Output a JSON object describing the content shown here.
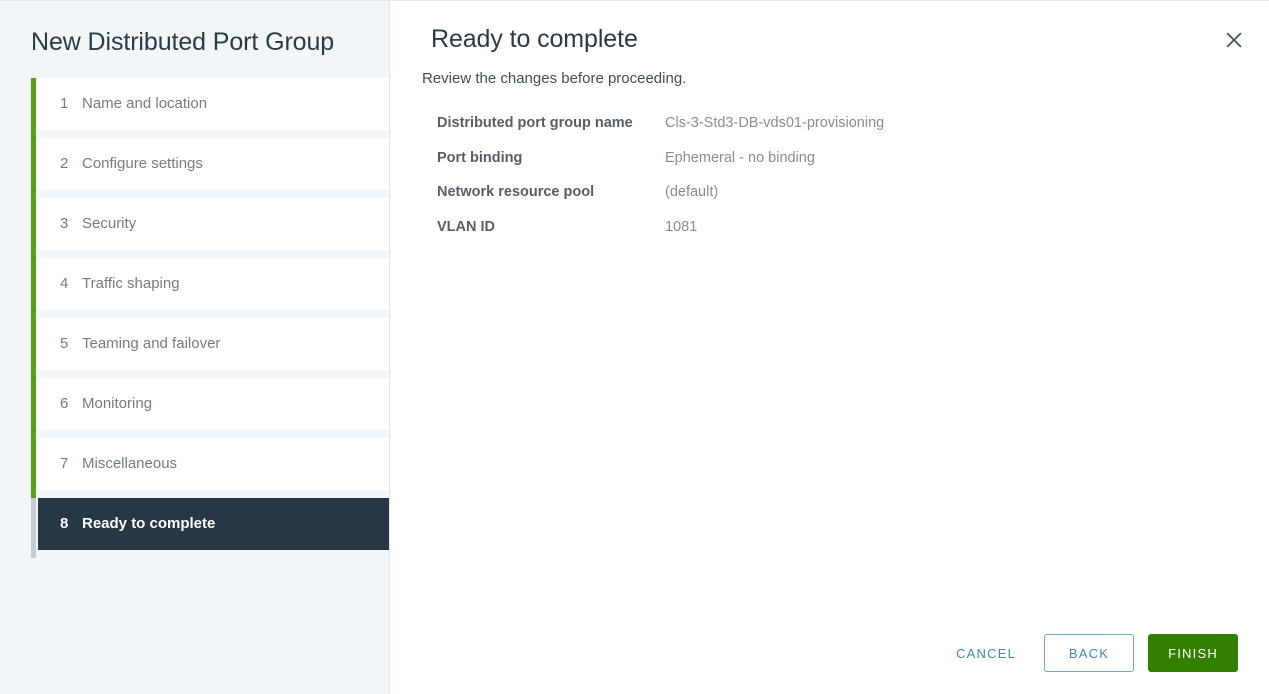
{
  "wizard": {
    "title": "New Distributed Port Group",
    "steps": [
      {
        "num": "1",
        "label": "Name and location",
        "state": "done"
      },
      {
        "num": "2",
        "label": "Configure settings",
        "state": "done"
      },
      {
        "num": "3",
        "label": "Security",
        "state": "done"
      },
      {
        "num": "4",
        "label": "Traffic shaping",
        "state": "done"
      },
      {
        "num": "5",
        "label": "Teaming and failover",
        "state": "done"
      },
      {
        "num": "6",
        "label": "Monitoring",
        "state": "done"
      },
      {
        "num": "7",
        "label": "Miscellaneous",
        "state": "done"
      },
      {
        "num": "8",
        "label": "Ready to complete",
        "state": "active"
      }
    ]
  },
  "page": {
    "title": "Ready to complete",
    "subtitle": "Review the changes before proceeding.",
    "close_icon": "close-icon",
    "summary": [
      {
        "key": "Distributed port group name",
        "value": "Cls-3-Std3-DB-vds01-provisioning"
      },
      {
        "key": "Port binding",
        "value": "Ephemeral - no binding"
      },
      {
        "key": "Network resource pool",
        "value": "(default)"
      },
      {
        "key": "VLAN ID",
        "value": "1081"
      }
    ]
  },
  "footer": {
    "cancel_label": "CANCEL",
    "back_label": "BACK",
    "finish_label": "FINISH"
  },
  "colors": {
    "progress_done": "#5b9c1f",
    "progress_pending": "#c5cdd2",
    "active_step_bg": "#263843",
    "sidebar_bg": "#f3f6f8",
    "link_blue": "#3f87ba",
    "finish_green": "#338000"
  }
}
